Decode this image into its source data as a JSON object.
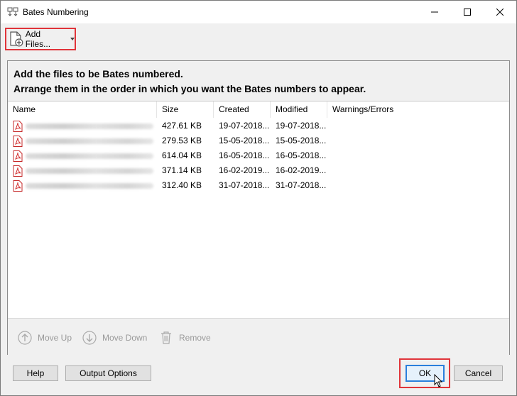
{
  "window": {
    "title": "Bates Numbering"
  },
  "toolbar": {
    "add_files_label": "Add Files..."
  },
  "instructions": {
    "line1": "Add the files to be Bates numbered.",
    "line2": "Arrange them in the order in which you want the Bates numbers to appear."
  },
  "table": {
    "columns": [
      "Name",
      "Size",
      "Created",
      "Modified",
      "Warnings/Errors"
    ],
    "rows": [
      {
        "size": "427.61 KB",
        "created": "19-07-2018...",
        "modified": "19-07-2018..."
      },
      {
        "size": "279.53 KB",
        "created": "15-05-2018...",
        "modified": "15-05-2018..."
      },
      {
        "size": "614.04 KB",
        "created": "16-05-2018...",
        "modified": "16-05-2018..."
      },
      {
        "size": "371.14 KB",
        "created": "16-02-2019...",
        "modified": "16-02-2019..."
      },
      {
        "size": "312.40 KB",
        "created": "31-07-2018...",
        "modified": "31-07-2018..."
      }
    ]
  },
  "actions": {
    "move_up": "Move Up",
    "move_down": "Move Down",
    "remove": "Remove"
  },
  "footer": {
    "help": "Help",
    "output_options": "Output Options",
    "ok": "OK",
    "cancel": "Cancel"
  },
  "colors": {
    "highlight": "#e0343a",
    "ok_border": "#2a7fdc",
    "pdf_red": "#d32f2f"
  }
}
